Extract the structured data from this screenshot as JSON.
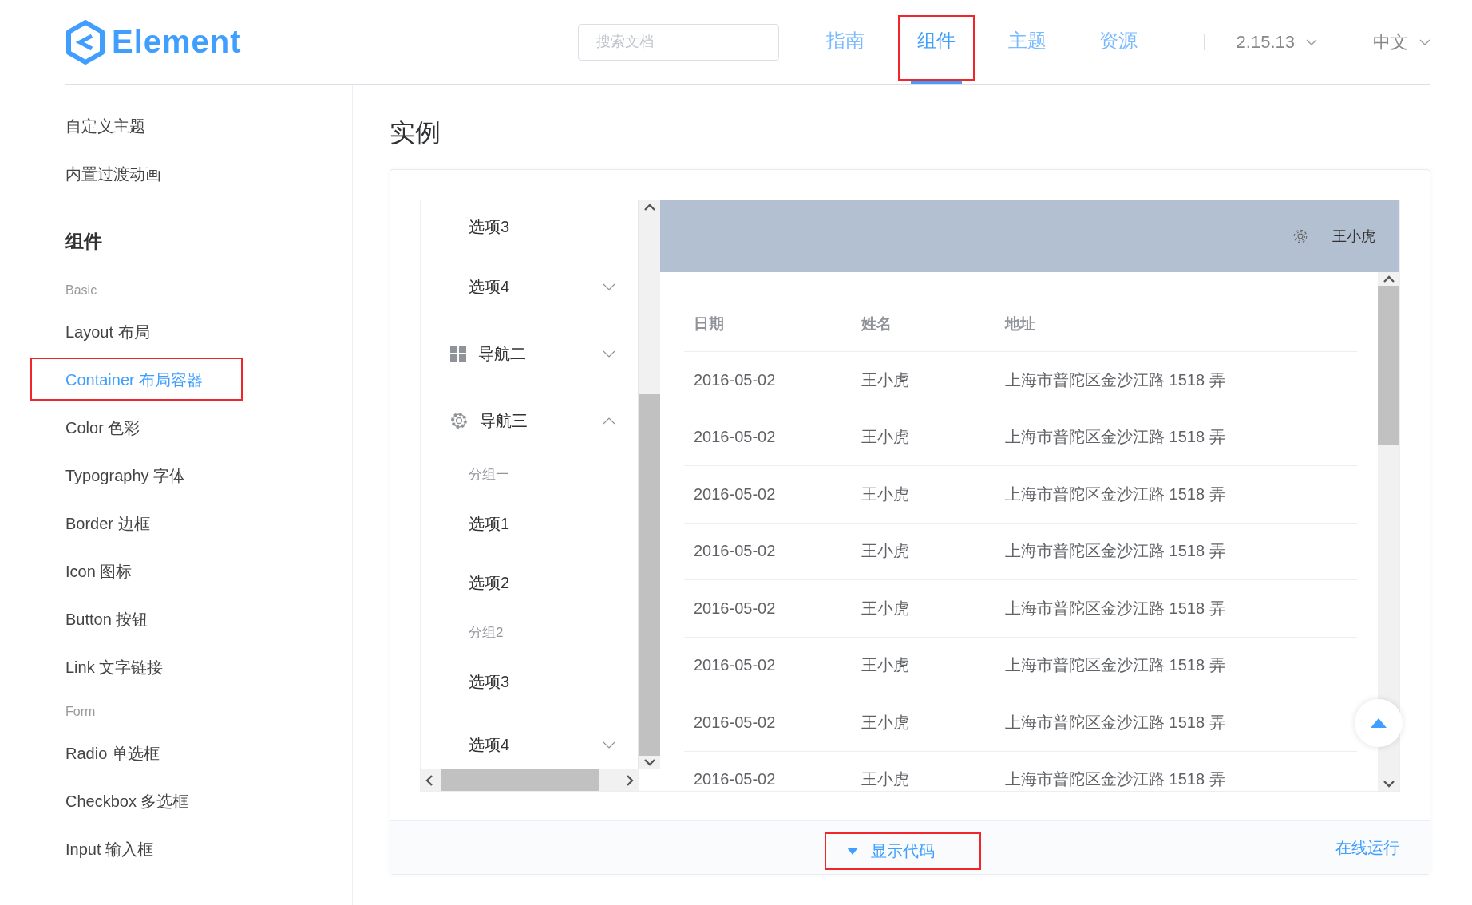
{
  "header": {
    "logo": "Element",
    "search": {
      "placeholder": "搜索文档"
    },
    "nav": [
      {
        "label": "指南",
        "selected": false,
        "highlighted": false
      },
      {
        "label": "组件",
        "selected": true,
        "highlighted": true
      },
      {
        "label": "主题",
        "selected": false,
        "highlighted": false
      },
      {
        "label": "资源",
        "selected": false,
        "highlighted": false
      }
    ],
    "version": "2.15.13",
    "language": "中文"
  },
  "sidebar": {
    "items": [
      {
        "kind": "link",
        "label": "自定义主题",
        "selected": false,
        "highlighted": false
      },
      {
        "kind": "link",
        "label": "内置过渡动画",
        "selected": false,
        "highlighted": false
      },
      {
        "kind": "heading",
        "label": "组件"
      },
      {
        "kind": "group",
        "label": "Basic"
      },
      {
        "kind": "link",
        "label": "Layout 布局",
        "selected": false,
        "highlighted": false
      },
      {
        "kind": "link",
        "label": "Container 布局容器",
        "selected": true,
        "highlighted": true
      },
      {
        "kind": "link",
        "label": "Color 色彩",
        "selected": false,
        "highlighted": false
      },
      {
        "kind": "link",
        "label": "Typography 字体",
        "selected": false,
        "highlighted": false
      },
      {
        "kind": "link",
        "label": "Border 边框",
        "selected": false,
        "highlighted": false
      },
      {
        "kind": "link",
        "label": "Icon 图标",
        "selected": false,
        "highlighted": false
      },
      {
        "kind": "link",
        "label": "Button 按钮",
        "selected": false,
        "highlighted": false
      },
      {
        "kind": "link",
        "label": "Link 文字链接",
        "selected": false,
        "highlighted": false
      },
      {
        "kind": "group",
        "label": "Form"
      },
      {
        "kind": "link",
        "label": "Radio 单选框",
        "selected": false,
        "highlighted": false
      },
      {
        "kind": "link",
        "label": "Checkbox 多选框",
        "selected": false,
        "highlighted": false
      },
      {
        "kind": "link",
        "label": "Input 输入框",
        "selected": false,
        "highlighted": false
      }
    ]
  },
  "content": {
    "title": "实例",
    "demo": {
      "menu": {
        "items": [
          {
            "kind": "item",
            "label": "选项3"
          },
          {
            "kind": "submenu",
            "label": "选项4",
            "expanded": false
          },
          {
            "kind": "nav",
            "label": "导航二",
            "expanded": false
          },
          {
            "kind": "nav",
            "label": "导航三",
            "expanded": true
          },
          {
            "kind": "group",
            "label": "分组一"
          },
          {
            "kind": "item",
            "label": "选项1"
          },
          {
            "kind": "item",
            "label": "选项2"
          },
          {
            "kind": "group",
            "label": "分组2"
          },
          {
            "kind": "item",
            "label": "选项3"
          },
          {
            "kind": "submenu",
            "label": "选项4",
            "expanded": false
          }
        ]
      },
      "header_user": "王小虎",
      "table": {
        "columns": [
          "日期",
          "姓名",
          "地址"
        ],
        "rows": [
          [
            "2016-05-02",
            "王小虎",
            "上海市普陀区金沙江路 1518 弄"
          ],
          [
            "2016-05-02",
            "王小虎",
            "上海市普陀区金沙江路 1518 弄"
          ],
          [
            "2016-05-02",
            "王小虎",
            "上海市普陀区金沙江路 1518 弄"
          ],
          [
            "2016-05-02",
            "王小虎",
            "上海市普陀区金沙江路 1518 弄"
          ],
          [
            "2016-05-02",
            "王小虎",
            "上海市普陀区金沙江路 1518 弄"
          ],
          [
            "2016-05-02",
            "王小虎",
            "上海市普陀区金沙江路 1518 弄"
          ],
          [
            "2016-05-02",
            "王小虎",
            "上海市普陀区金沙江路 1518 弄"
          ],
          [
            "2016-05-02",
            "王小虎",
            "上海市普陀区金沙江路 1518 弄"
          ]
        ]
      }
    },
    "footer": {
      "show_code": {
        "label": "显示代码",
        "highlighted": true
      },
      "run_online": "在线运行"
    }
  }
}
